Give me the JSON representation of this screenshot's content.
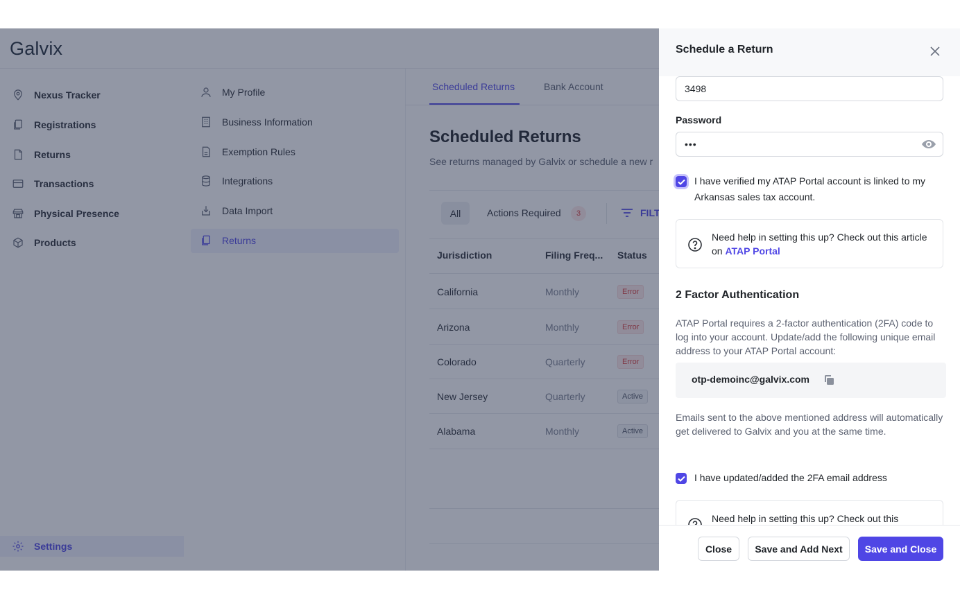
{
  "app": {
    "logo": "Galvix"
  },
  "sidebar": {
    "items": [
      {
        "label": "Nexus Tracker",
        "icon": "location-pin-icon"
      },
      {
        "label": "Registrations",
        "icon": "documents-icon"
      },
      {
        "label": "Returns",
        "icon": "file-icon"
      },
      {
        "label": "Transactions",
        "icon": "card-icon"
      },
      {
        "label": "Physical Presence",
        "icon": "store-icon"
      },
      {
        "label": "Products",
        "icon": "box-icon"
      }
    ],
    "settings_label": "Settings"
  },
  "settings_menu": {
    "items": [
      {
        "label": "My Profile",
        "icon": "user-icon"
      },
      {
        "label": "Business Information",
        "icon": "building-icon"
      },
      {
        "label": "Exemption Rules",
        "icon": "document-icon"
      },
      {
        "label": "Integrations",
        "icon": "database-icon"
      },
      {
        "label": "Data Import",
        "icon": "import-icon"
      },
      {
        "label": "Returns",
        "icon": "documents-icon",
        "active": true
      }
    ]
  },
  "main": {
    "tabs": [
      {
        "label": "Scheduled Returns",
        "active": true
      },
      {
        "label": "Bank Account"
      }
    ],
    "title": "Scheduled Returns",
    "subtitle": "See returns managed by Galvix or schedule a new r",
    "filters": {
      "all_label": "All",
      "actions_required_label": "Actions Required",
      "actions_required_count": "3",
      "filter_label": "FILT"
    },
    "table": {
      "headers": [
        "Jurisdiction",
        "Filing Freq...",
        "Status"
      ],
      "rows": [
        {
          "jurisdiction": "California",
          "frequency": "Monthly",
          "status": "Error"
        },
        {
          "jurisdiction": "Arizona",
          "frequency": "Monthly",
          "status": "Error"
        },
        {
          "jurisdiction": "Colorado",
          "frequency": "Quarterly",
          "status": "Error"
        },
        {
          "jurisdiction": "New Jersey",
          "frequency": "Quarterly",
          "status": "Active"
        },
        {
          "jurisdiction": "Alabama",
          "frequency": "Monthly",
          "status": "Active"
        }
      ]
    }
  },
  "drawer": {
    "title": "Schedule a Return",
    "username_value": "3498",
    "password_label": "Password",
    "password_value": "•••",
    "verify_checkbox_label": "I have verified my ATAP Portal account is linked to my Arkansas sales tax account.",
    "help1_text": "Need help in setting this up? Check out this article on ",
    "help1_link": "ATAP Portal",
    "twofa_title": "2 Factor Authentication",
    "twofa_desc": "ATAP Portal requires a 2-factor authentication (2FA) code to log into your account. Update/add the following unique email address to your ATAP Portal account:",
    "otp_email": "otp-demoinc@galvix.com",
    "emails_note": "Emails sent to the above mentioned address will automatically get delivered to Galvix and you at the same time.",
    "updated_checkbox_label": "I have updated/added the 2FA email address",
    "help2_text": "Need help in setting this up? Check out this",
    "buttons": {
      "close": "Close",
      "save_add_next": "Save and Add Next",
      "save_close": "Save and Close"
    },
    "colors": {
      "accent": "#4f46e5",
      "error": "#d94141"
    }
  }
}
